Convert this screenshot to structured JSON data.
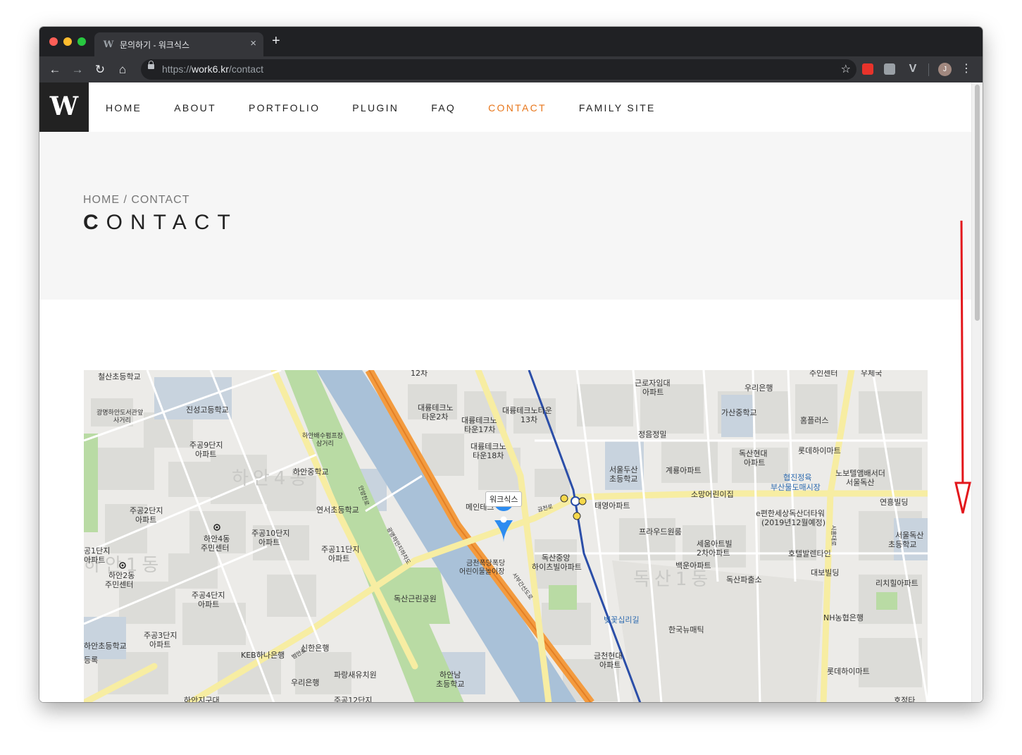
{
  "browser": {
    "tab_title": "문의하기 - 워크식스",
    "tab_favicon": "W",
    "tab_close": "×",
    "new_tab": "+",
    "url_scheme": "https://",
    "url_host": "work6.kr",
    "url_path": "/contact",
    "avatar_initial": "J"
  },
  "site": {
    "logo": "W",
    "nav": [
      {
        "label": "HOME"
      },
      {
        "label": "ABOUT"
      },
      {
        "label": "PORTFOLIO"
      },
      {
        "label": "PLUGIN"
      },
      {
        "label": "FAQ"
      },
      {
        "label": "CONTACT",
        "active": true
      },
      {
        "label": "FAMILY SITE"
      }
    ],
    "accent_color": "#e8771c"
  },
  "hero": {
    "breadcrumb": "HOME / CONTACT",
    "title_first": "C",
    "title_rest": "ONTACT"
  },
  "map": {
    "marker_label": "워크식스",
    "labels": {
      "l1": "철산초등학교",
      "l2": "진성고등학교",
      "l3": "광명하안도서관앞",
      "l4": "사거리",
      "l5": "주공9단지",
      "l6": "아파트",
      "l7": "하안4동",
      "l8": "하안배수펌프장",
      "l9": "삼거리",
      "l10": "하안중학교",
      "l11": "연서초등학교",
      "l12": "주공2단지",
      "l13": "아파트",
      "l14": "하안4동",
      "l15": "주민센터",
      "l16": "주공10단지",
      "l17": "아파트",
      "l18": "주공11단지",
      "l19": "아파트",
      "l20": "하안2동",
      "l21": "주민센터",
      "l22": "주공4단지",
      "l23": "아파트",
      "l24": "주공3단지",
      "l25": "아파트",
      "l26": "하안초등학교",
      "l27": "KEB하나은행",
      "l28": "신한은행",
      "l29": "우리은행",
      "l30": "파랑새유치원",
      "l31": "하안지구대",
      "l32": "하안남",
      "l33": "초등학교",
      "l34": "12차",
      "l35": "대륭테크노",
      "l36": "타운2차",
      "l37": "대륭테크노",
      "l38": "타운17차",
      "l39": "대륭테크노타운",
      "l40": "13차",
      "l41": "대륭테크노",
      "l42": "타운18차",
      "l43": "메인테크",
      "l44": "금천폭당폭당",
      "l45": "어린이물놀이장",
      "l46": "독산근린공원",
      "l47": "독산중앙",
      "l48": "하이츠빌아파트",
      "l49": "태영아파트",
      "l50": "근로자임대",
      "l51": "아파트",
      "l52": "정음정밀",
      "l53": "서울두산",
      "l54": "초등학교",
      "l55": "계룡아파트",
      "l56": "소망어린이집",
      "l57": "우리은행",
      "l58": "가산중학교",
      "l59": "홈플러스",
      "l60": "독산현대",
      "l61": "아파트",
      "l62": "롯데하이마트",
      "l63": "협진정육",
      "l64": "부산물도매시장",
      "l65": "노보텔앰배서더",
      "l66": "서울독산",
      "l67": "연흥빌딩",
      "l68": "e편한세상독산더타워",
      "l69": "(2019년12월예정)",
      "l70": "프라우드원룸",
      "l71": "세움아트빌",
      "l72": "2차아파트",
      "l73": "독산1동",
      "l74": "백운아파트",
      "l75": "독산파출소",
      "l76": "호텔발렌타인",
      "l77": "대보빌딩",
      "l78": "서울독산",
      "l79": "초등학교",
      "l80": "리치힐아파트",
      "l81": "벚꽃십리길",
      "l82": "한국뉴매틱",
      "l83": "NH농협은행",
      "l84": "금천현대",
      "l85": "아파트",
      "l86": "롯데하이마트",
      "l87": "주인센터",
      "l88": "우체국",
      "l89": "하안1동",
      "l90": "범안로",
      "l91": "안양천로",
      "l92": "서부간선도로",
      "l93": "주공12단지",
      "l94": "호정타",
      "l95": "금천로",
      "l96": "시흥대로",
      "l97": "등록",
      "l98": "공1단지",
      "l99": "아파트",
      "l100": "광명하안지하차도",
      "l101": "주공10단지",
      "l102": "하안1동"
    }
  }
}
